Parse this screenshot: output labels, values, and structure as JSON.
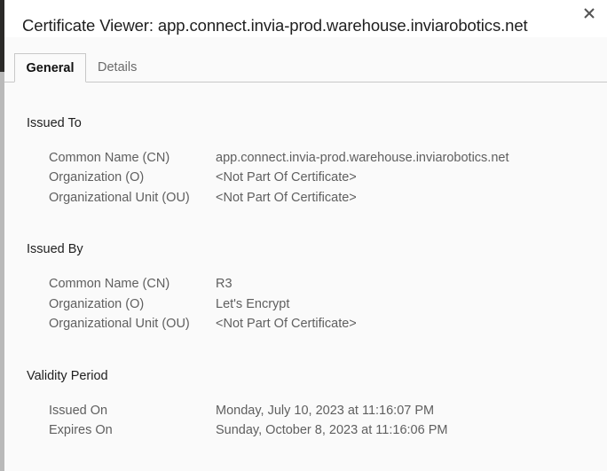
{
  "dialog": {
    "title": "Certificate Viewer: app.connect.invia-prod.warehouse.inviarobotics.net",
    "close_icon": "close-icon"
  },
  "tabs": [
    {
      "label": "General",
      "active": true
    },
    {
      "label": "Details",
      "active": false
    }
  ],
  "sections": {
    "issued_to": {
      "title": "Issued To",
      "rows": [
        {
          "label": "Common Name (CN)",
          "value": "app.connect.invia-prod.warehouse.inviarobotics.net"
        },
        {
          "label": "Organization (O)",
          "value": "<Not Part Of Certificate>"
        },
        {
          "label": "Organizational Unit (OU)",
          "value": "<Not Part Of Certificate>"
        }
      ]
    },
    "issued_by": {
      "title": "Issued By",
      "rows": [
        {
          "label": "Common Name (CN)",
          "value": "R3"
        },
        {
          "label": "Organization (O)",
          "value": "Let's Encrypt"
        },
        {
          "label": "Organizational Unit (OU)",
          "value": "<Not Part Of Certificate>"
        }
      ]
    },
    "validity": {
      "title": "Validity Period",
      "rows": [
        {
          "label": "Issued On",
          "value": "Monday, July 10, 2023 at 11:16:07 PM"
        },
        {
          "label": "Expires On",
          "value": "Sunday, October 8, 2023 at 11:16:06 PM"
        }
      ]
    }
  }
}
